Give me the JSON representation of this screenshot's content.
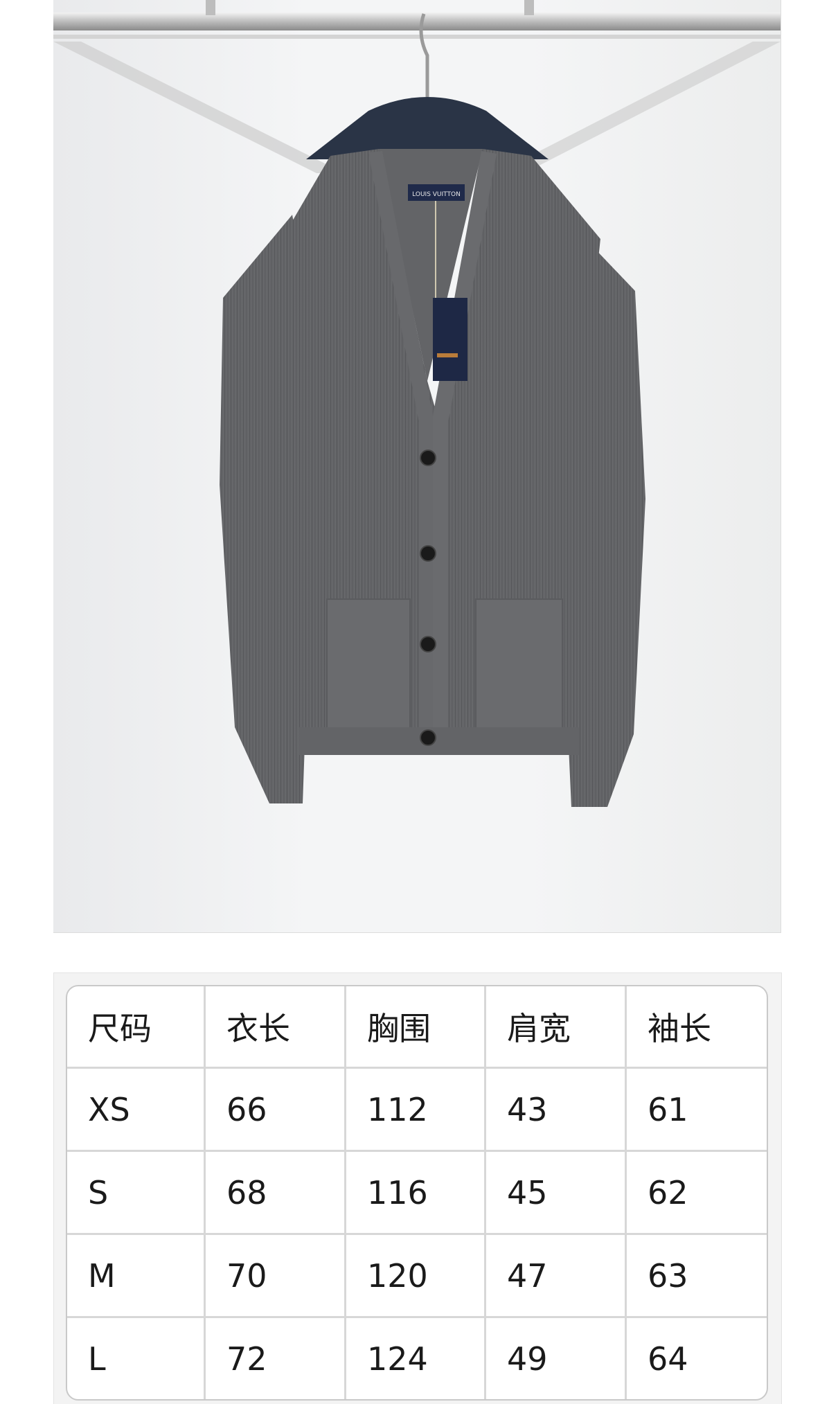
{
  "product": {
    "image_icon": "grey-knit-cardigan-photo",
    "garment_color": "#6c6d70"
  },
  "size_table": {
    "headers": [
      "尺码",
      "衣长",
      "胸围",
      "肩宽",
      "袖长"
    ],
    "rows": [
      [
        "XS",
        "66",
        "112",
        "43",
        "61"
      ],
      [
        "S",
        "68",
        "116",
        "45",
        "62"
      ],
      [
        "M",
        "70",
        "120",
        "47",
        "63"
      ],
      [
        "L",
        "72",
        "124",
        "49",
        "64"
      ]
    ]
  }
}
